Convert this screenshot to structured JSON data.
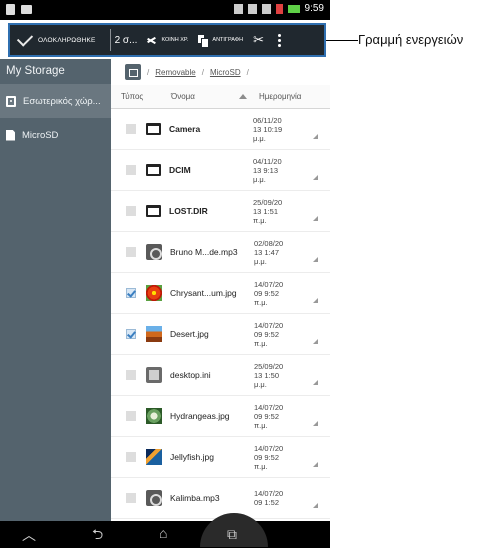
{
  "status_bar": {
    "time": "9:59"
  },
  "action_bar": {
    "done_label": "ΟΛΟΚΛΗΡΩΘΗΚΕ",
    "selected_count": "2 σ...",
    "share_label": "ΚΟΙΝΗ ΧΡ.",
    "copy_label": "ΑΝΤΙΓΡΑΦΗ"
  },
  "callout": {
    "text": "Γραμμή ενεργειών"
  },
  "sidebar": {
    "title": "My Storage",
    "items": [
      {
        "label": "Εσωτερικός χώρ...",
        "icon": "device-icon"
      },
      {
        "label": "MicroSD",
        "icon": "sd-card-icon"
      }
    ]
  },
  "path": {
    "crumb1": "Removable",
    "crumb2": "MicroSD"
  },
  "columns": {
    "type": "Τύπος",
    "name": "Όνομα",
    "date": "Ημερομηνία"
  },
  "files": [
    {
      "name": "Camera",
      "date": "06/11/20\n13 10:19\nμ.μ.",
      "kind": "folder",
      "checked": false,
      "bold": true
    },
    {
      "name": "DCIM",
      "date": "04/11/20\n13 9:13\nμ.μ.",
      "kind": "folder",
      "checked": false,
      "bold": true
    },
    {
      "name": "LOST.DIR",
      "date": "25/09/20\n13 1:51\nπ.μ.",
      "kind": "folder",
      "checked": false,
      "bold": true
    },
    {
      "name": "Bruno M...de.mp3",
      "date": "02/08/20\n13 1:47\nμ.μ.",
      "kind": "music",
      "checked": false,
      "bold": false
    },
    {
      "name": "Chrysant...um.jpg",
      "date": "14/07/20\n09 9:52\nπ.μ.",
      "kind": "flower",
      "checked": true,
      "bold": false
    },
    {
      "name": "Desert.jpg",
      "date": "14/07/20\n09 9:52\nπ.μ.",
      "kind": "desert",
      "checked": true,
      "bold": false
    },
    {
      "name": "desktop.ini",
      "date": "25/09/20\n13 1:50\nμ.μ.",
      "kind": "doc",
      "checked": false,
      "bold": false
    },
    {
      "name": "Hydrangeas.jpg",
      "date": "14/07/20\n09 9:52\nπ.μ.",
      "kind": "hydra",
      "checked": false,
      "bold": false
    },
    {
      "name": "Jellyfish.jpg",
      "date": "14/07/20\n09 9:52\nπ.μ.",
      "kind": "jelly",
      "checked": false,
      "bold": false
    },
    {
      "name": "Kalimba.mp3",
      "date": "14/07/20\n09 1:52",
      "kind": "music",
      "checked": false,
      "bold": false
    }
  ]
}
